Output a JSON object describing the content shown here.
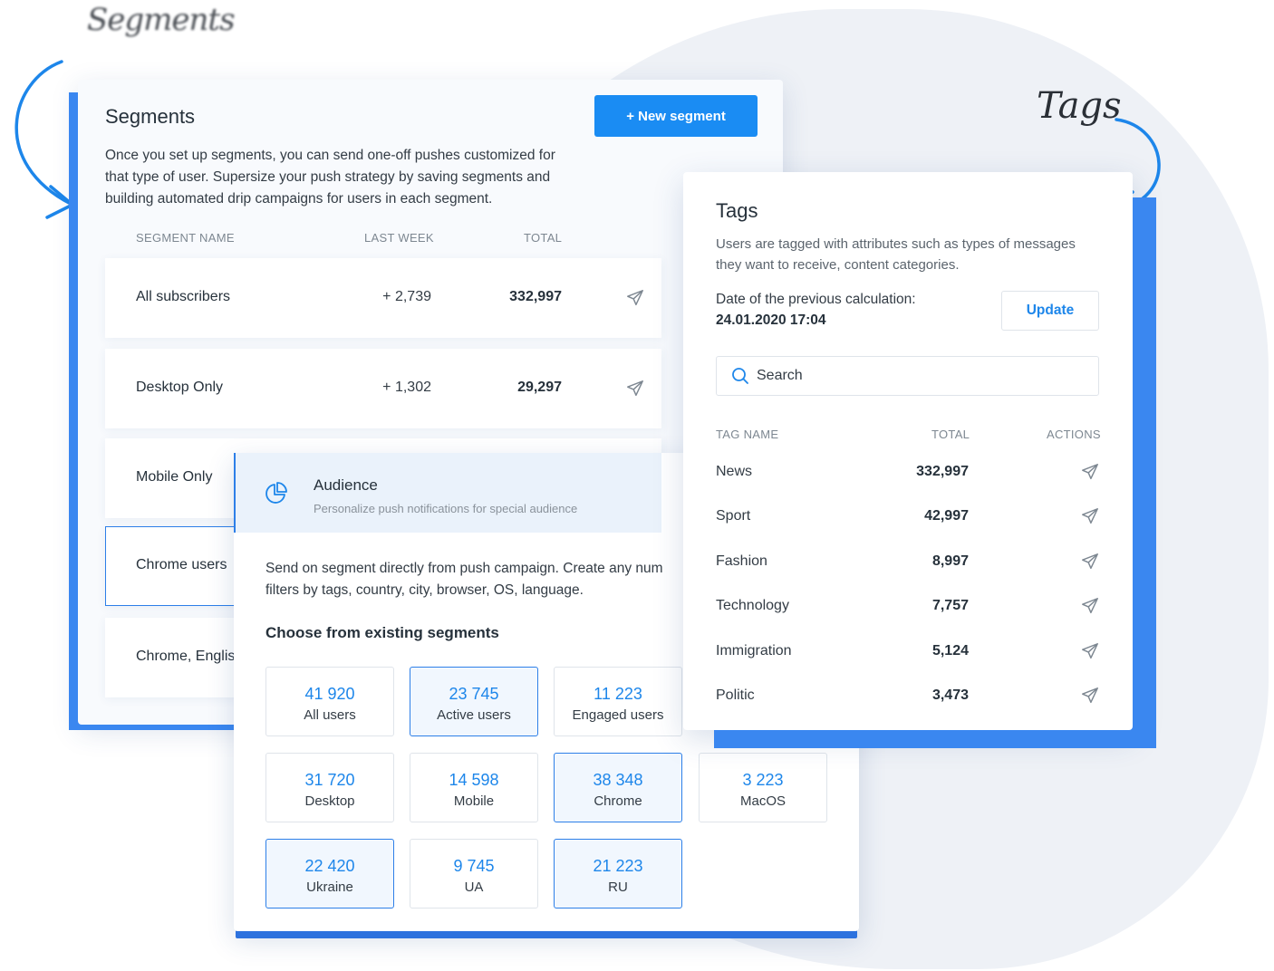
{
  "annotations": {
    "segments_label": "Segments",
    "tags_label": "Tags"
  },
  "colors": {
    "accent": "#1a8cf3",
    "selected_border": "#2d7fe8",
    "number_blue": "#1d86ea",
    "background_blob": "#eef1f6"
  },
  "segments": {
    "title": "Segments",
    "new_button": "+ New segment",
    "description": "Once you set up segments, you can send one-off pushes customized for that type of user. Supersize your push strategy by saving segments and building automated drip campaigns for users in each segment.",
    "columns": {
      "name": "SEGMENT NAME",
      "last_week": "LAST WEEK",
      "total": "TOTAL"
    },
    "rows": [
      {
        "name": "All subscribers",
        "last_week": "+ 2,739",
        "total": "332,997",
        "icon": "send-icon"
      },
      {
        "name": "Desktop Only",
        "last_week": "+ 1,302",
        "total": "29,297",
        "icon": "send-icon"
      },
      {
        "name": "Mobile Only"
      },
      {
        "name": "Chrome users"
      },
      {
        "name": "Chrome, English"
      }
    ]
  },
  "audience": {
    "icon": "pie-chart-icon",
    "title": "Audience",
    "subtitle": "Personalize push notifications for special audience",
    "desc_line1": "Send on segment directly from push campaign. Create any num",
    "desc_line2": "filters by tags, country, city, browser, OS, language.",
    "choose_title": "Choose from existing segments",
    "tiles": [
      {
        "value": "41 920",
        "label": "All users",
        "selected": false
      },
      {
        "value": "23 745",
        "label": "Active users",
        "selected": true
      },
      {
        "value": "11 223",
        "label": "Engaged users",
        "selected": false
      },
      {
        "value": "31 720",
        "label": "Desktop",
        "selected": false
      },
      {
        "value": "14 598",
        "label": "Mobile",
        "selected": false
      },
      {
        "value": "38 348",
        "label": "Chrome",
        "selected": true
      },
      {
        "value": "3 223",
        "label": "MacOS",
        "selected": false
      },
      {
        "value": "22 420",
        "label": "Ukraine",
        "selected": true
      },
      {
        "value": "9 745",
        "label": "UA",
        "selected": false
      },
      {
        "value": "21 223",
        "label": "RU",
        "selected": true
      }
    ]
  },
  "tags": {
    "title": "Tags",
    "description": "Users are tagged with attributes such as types of messages they want to receive, content categories.",
    "date_label": "Date of the previous calculation:",
    "date_value": "24.01.2020 17:04",
    "update_button": "Update",
    "search_placeholder": "Search",
    "columns": {
      "name": "TAG NAME",
      "total": "TOTAL",
      "actions": "ACTIONS"
    },
    "rows": [
      {
        "name": "News",
        "total": "332,997",
        "icon": "send-icon"
      },
      {
        "name": "Sport",
        "total": "42,997",
        "icon": "send-icon"
      },
      {
        "name": "Fashion",
        "total": "8,997",
        "icon": "send-icon"
      },
      {
        "name": "Technology",
        "total": "7,757",
        "icon": "send-icon"
      },
      {
        "name": "Immigration",
        "total": "5,124",
        "icon": "send-icon"
      },
      {
        "name": "Politic",
        "total": "3,473",
        "icon": "send-icon"
      }
    ]
  }
}
